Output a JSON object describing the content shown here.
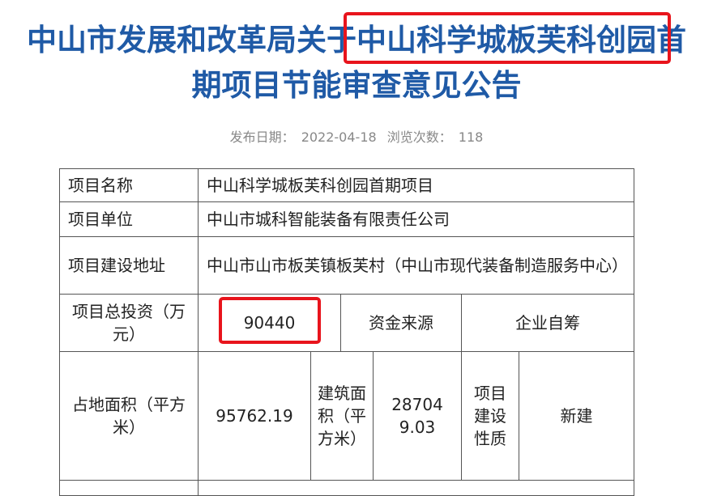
{
  "title": {
    "line1": "中山市发展和改革局关于中山科学城板芙科创园首",
    "line2": "期项目节能审查意见公告"
  },
  "meta": {
    "publish_label": "发布日期：",
    "publish_date": "2022-04-18",
    "views_label": "浏览次数：",
    "views_count": "118"
  },
  "table": {
    "project_name_label": "项目名称",
    "project_name_value": "中山科学城板芙科创园首期项目",
    "unit_label": "项目单位",
    "unit_value": "中山市城科智能装备有限责任公司",
    "address_label": "项目建设地址",
    "address_value": "中山市山市板芙镇板芙村（中山市现代装备制造服务中心）",
    "investment_label": "项目总投资（万元）",
    "investment_value": "90440",
    "fund_source_label": "资金来源",
    "fund_source_value": "企业自筹",
    "land_area_label": "占地面积（平方米）",
    "land_area_value": "95762.19",
    "building_area_label": "建筑面积（平方米）",
    "building_area_value": "287049.03",
    "construction_type_label": "项目建设性质",
    "construction_type_value": "新建"
  },
  "colors": {
    "title": "#1f5aa6",
    "highlight": "#e8141c"
  }
}
